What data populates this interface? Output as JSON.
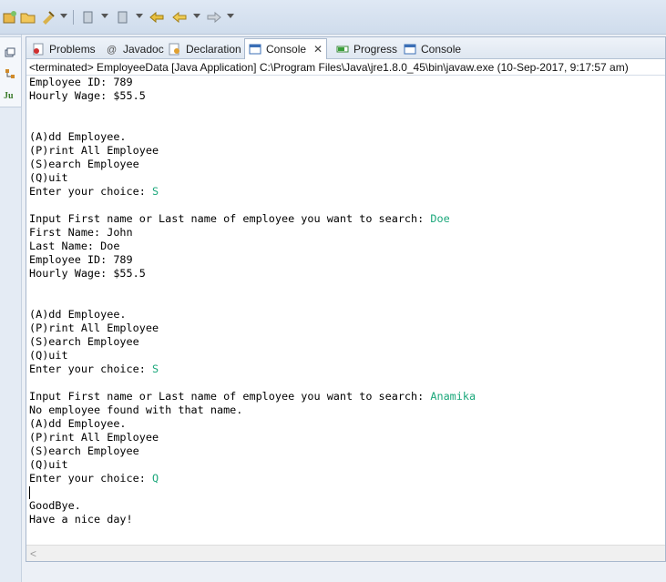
{
  "tabs": [
    {
      "label": "Problems",
      "icon": "problems-icon",
      "active": false
    },
    {
      "label": "Javadoc",
      "icon": "javadoc-icon",
      "active": false
    },
    {
      "label": "Declaration",
      "icon": "declaration-icon",
      "active": false
    },
    {
      "label": "Console",
      "icon": "console-icon",
      "active": true,
      "close": "✕"
    },
    {
      "label": "Progress",
      "icon": "progress-icon",
      "active": false
    },
    {
      "label": "Console",
      "icon": "console-icon",
      "active": false
    }
  ],
  "status": "<terminated> EmployeeData [Java Application] C:\\Program Files\\Java\\jre1.8.0_45\\bin\\javaw.exe (10-Sep-2017, 9:17:57 am)",
  "console_lines": [
    {
      "text": "Employee ID: 789",
      "input": ""
    },
    {
      "text": "Hourly Wage: $55.5",
      "input": ""
    },
    {
      "text": "",
      "input": ""
    },
    {
      "text": "",
      "input": ""
    },
    {
      "text": "(A)dd Employee.",
      "input": ""
    },
    {
      "text": "(P)rint All Employee",
      "input": ""
    },
    {
      "text": "(S)earch Employee",
      "input": ""
    },
    {
      "text": "(Q)uit",
      "input": ""
    },
    {
      "text": "Enter your choice: ",
      "input": "S"
    },
    {
      "text": "",
      "input": ""
    },
    {
      "text": "Input First name or Last name of employee you want to search: ",
      "input": "Doe"
    },
    {
      "text": "First Name: John",
      "input": ""
    },
    {
      "text": "Last Name: Doe",
      "input": ""
    },
    {
      "text": "Employee ID: 789",
      "input": ""
    },
    {
      "text": "Hourly Wage: $55.5",
      "input": ""
    },
    {
      "text": "",
      "input": ""
    },
    {
      "text": "",
      "input": ""
    },
    {
      "text": "(A)dd Employee.",
      "input": ""
    },
    {
      "text": "(P)rint All Employee",
      "input": ""
    },
    {
      "text": "(S)earch Employee",
      "input": ""
    },
    {
      "text": "(Q)uit",
      "input": ""
    },
    {
      "text": "Enter your choice: ",
      "input": "S"
    },
    {
      "text": "",
      "input": ""
    },
    {
      "text": "Input First name or Last name of employee you want to search: ",
      "input": "Anamika"
    },
    {
      "text": "No employee found with that name.",
      "input": ""
    },
    {
      "text": "(A)dd Employee.",
      "input": ""
    },
    {
      "text": "(P)rint All Employee",
      "input": ""
    },
    {
      "text": "(S)earch Employee",
      "input": ""
    },
    {
      "text": "(Q)uit",
      "input": ""
    },
    {
      "text": "Enter your choice: ",
      "input": "Q"
    },
    {
      "text": "",
      "input": "",
      "cursor": true
    },
    {
      "text": "GoodBye.",
      "input": ""
    },
    {
      "text": "Have a nice day!",
      "input": ""
    }
  ],
  "colors": {
    "user_input": "#1aa77a",
    "accent": "#3b6fb6"
  }
}
